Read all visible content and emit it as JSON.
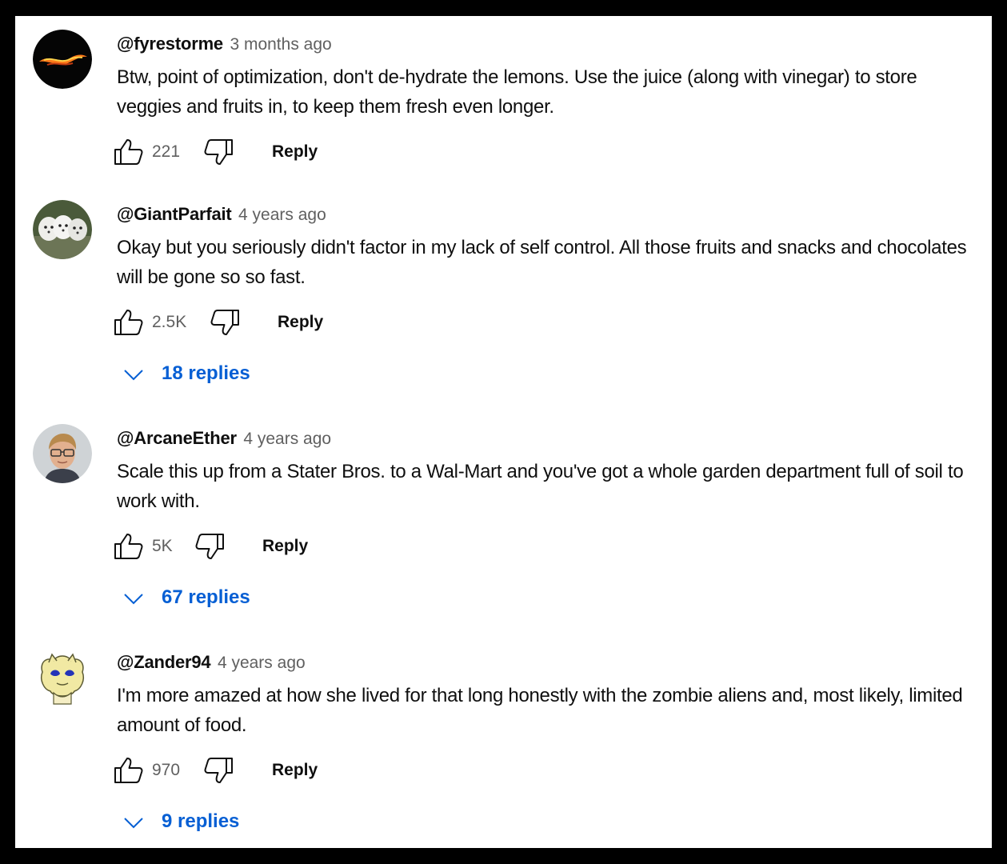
{
  "colors": {
    "reply_link": "#065fd4",
    "meta_text": "#606060",
    "body_text": "#0f0f0f"
  },
  "icons": {
    "like": "thumbs-up-outline",
    "dislike": "thumbs-down-outline",
    "expand": "chevron-down"
  },
  "comments": [
    {
      "author": "@fyrestorme",
      "time": "3 months ago",
      "text": "Btw, point of optimization, don't de-hydrate the lemons. Use the juice (along with vinegar) to store veggies and fruits in, to keep them fresh even longer.",
      "likes": "221",
      "reply_label": "Reply",
      "avatar": "flame-swirl"
    },
    {
      "author": "@GiantParfait",
      "time": "4 years ago",
      "text": "Okay but you seriously didn't factor in my lack of self control. All those fruits and snacks and chocolates will be gone so so fast.",
      "likes": "2.5K",
      "reply_label": "Reply",
      "replies": "18 replies",
      "avatar": "white-puppies"
    },
    {
      "author": "@ArcaneEther",
      "time": "4 years ago",
      "text": "Scale this up from a Stater Bros. to a Wal-Mart and you've got a whole garden department full of soil to work with.",
      "likes": "5K",
      "reply_label": "Reply",
      "replies": "67 replies",
      "avatar": "man-with-glasses"
    },
    {
      "author": "@Zander94",
      "time": "4 years ago",
      "text": "I'm more amazed at how she lived for that long honestly with the zombie aliens and, most likely, limited amount of food.",
      "likes": "970",
      "reply_label": "Reply",
      "replies": "9 replies",
      "avatar": "cartoon-creature"
    }
  ]
}
